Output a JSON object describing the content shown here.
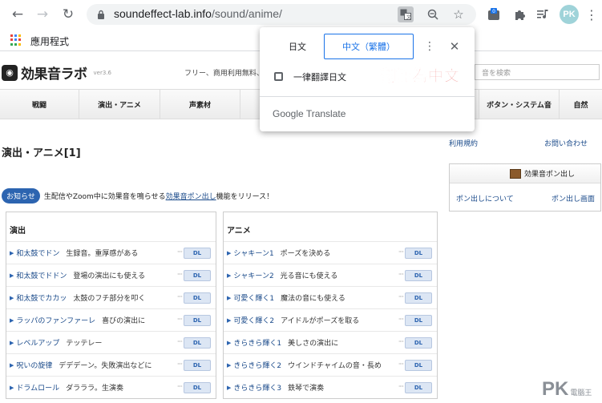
{
  "browser": {
    "url_domain": "soundeffect-lab.info",
    "url_path": "/sound/anime/",
    "extension_badge": "0",
    "profile_initials": "PK",
    "bookmark_apps_label": "應用程式"
  },
  "site": {
    "logo_text": "効果音ラボ",
    "logo_version": "ver3.6",
    "tagline": "フリー、商用利用無料、",
    "search_placeholder": "音を検索",
    "nav": [
      "戦闘",
      "演出・アニメ",
      "声素材",
      "",
      "",
      "ボタン・システム音",
      "自然"
    ],
    "page_title": "演出・アニメ[1]",
    "side_links": [
      "利用規約",
      "お問い合わせ"
    ],
    "side_box": {
      "title": "効果音ポン出し",
      "left_link": "ポン出しについて",
      "right_link": "ポン出し画面"
    },
    "notice": {
      "badge": "お知らせ",
      "text_before": "生配信やZoom中に効果音を鳴らせる",
      "link": "効果音ポン出し",
      "text_after": "機能をリリース！"
    },
    "dl_label": "DL",
    "columns": [
      {
        "heading": "演出",
        "items": [
          {
            "name": "和太鼓でドン",
            "desc": "生録音。重厚感がある"
          },
          {
            "name": "和太鼓でドドン",
            "desc": "登場の演出にも使える"
          },
          {
            "name": "和太鼓でカカッ",
            "desc": "太鼓のフチ部分を叩く"
          },
          {
            "name": "ラッパのファンファーレ",
            "desc": "喜びの演出に"
          },
          {
            "name": "レベルアップ",
            "desc": "テッテレー"
          },
          {
            "name": "呪いの旋律",
            "desc": "デデデーン。失敗演出などに"
          },
          {
            "name": "ドラムロール",
            "desc": "ダラララ。生演奏"
          }
        ]
      },
      {
        "heading": "アニメ",
        "items": [
          {
            "name": "シャキーン1",
            "desc": "ポーズを決める"
          },
          {
            "name": "シャキーン2",
            "desc": "光る音にも使える"
          },
          {
            "name": "可愛く輝く1",
            "desc": "魔法の音にも使える"
          },
          {
            "name": "可愛く輝く2",
            "desc": "アイドルがポーズを取る"
          },
          {
            "name": "きらきら輝く1",
            "desc": "美しさの演出に"
          },
          {
            "name": "きらきら輝く2",
            "desc": "ウインドチャイムの音・長め"
          },
          {
            "name": "きらきら輝く3",
            "desc": "鉄琴で演奏"
          }
        ]
      }
    ]
  },
  "translate_popup": {
    "tab_source": "日文",
    "tab_target": "中文（繁體）",
    "always_translate_label": "一律翻譯日文",
    "brand": "Google Translate"
  },
  "annotation": "翻譯為中文",
  "watermark": {
    "big": "PK",
    "small": "電腦王"
  },
  "colors": {
    "accent": "#1a73e8",
    "annotation": "#e53935",
    "link": "#1a4a8a",
    "badge": "#2c64b0"
  }
}
